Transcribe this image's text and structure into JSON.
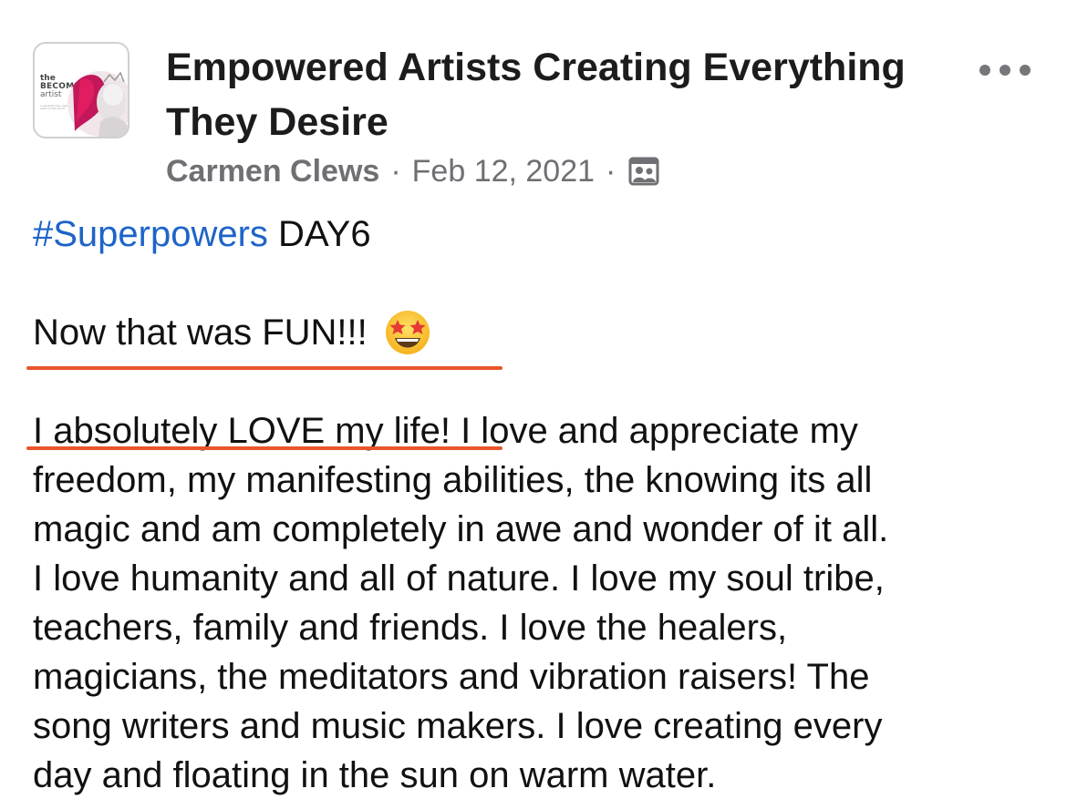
{
  "group": {
    "title": "Empowered Artists Creating Everything They Desire",
    "avatar": {
      "line1": "the",
      "line2": "BECOMING",
      "line3": "artist",
      "tagline": "a revolutionary new way of being an artist in the world"
    }
  },
  "post": {
    "author": "Carmen Clews",
    "date": "Feb 12, 2021",
    "separator": "·",
    "audience_icon": "members-photo-icon",
    "hashtag": "#Superpowers",
    "day_label": " DAY6",
    "fun_line": "Now that was FUN!!!",
    "emoji": "star-struck-emoji",
    "body_lines": [
      "I absolutely LOVE my life! I love and appreciate my",
      "freedom, my manifesting abilities, the knowing its all",
      "magic and am completely in awe and wonder of it all.",
      "I love humanity and all of nature. I love my soul tribe,",
      "teachers, family and friends. I love the healers,",
      "magicians, the meditators and vibration raisers! The",
      "song writers and music makers. I love creating every",
      "day and floating in the sun on warm water."
    ]
  },
  "colors": {
    "hashtag": "#1e64c8",
    "underline": "#e8562b",
    "meta_text": "#6f6f74"
  }
}
